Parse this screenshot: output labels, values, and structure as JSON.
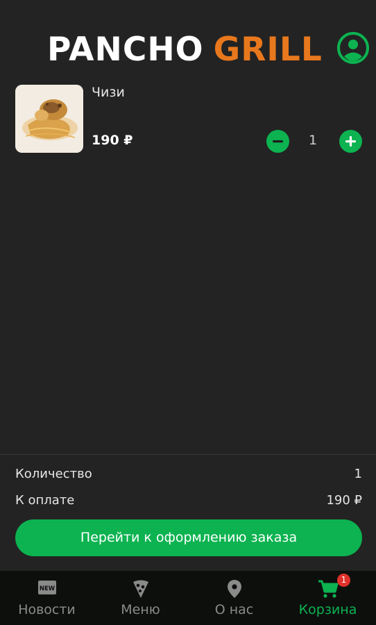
{
  "header": {
    "logo_part1": "PANCHO",
    "logo_part2": "GRILL",
    "accent_color": "#e8781d",
    "profile_icon": "user-circle-icon"
  },
  "cart": {
    "items": [
      {
        "name": "Чизи",
        "price": "190 ₽",
        "quantity": "1",
        "image": "food-photo"
      }
    ]
  },
  "summary": {
    "quantity_label": "Количество",
    "quantity_value": "1",
    "total_label": "К оплате",
    "total_value": "190 ₽",
    "checkout_label": "Перейти к оформлению заказа"
  },
  "nav": {
    "items": [
      {
        "label": "Новости",
        "icon": "news-icon",
        "active": false
      },
      {
        "label": "Меню",
        "icon": "pizza-slice-icon",
        "active": false
      },
      {
        "label": "О нас",
        "icon": "location-pin-icon",
        "active": false
      },
      {
        "label": "Корзина",
        "icon": "cart-icon",
        "active": true,
        "badge": "1"
      }
    ]
  },
  "colors": {
    "primary": "#0cb350",
    "background": "#232323",
    "nav_background": "#0d0f0d",
    "badge": "#e0312b"
  }
}
